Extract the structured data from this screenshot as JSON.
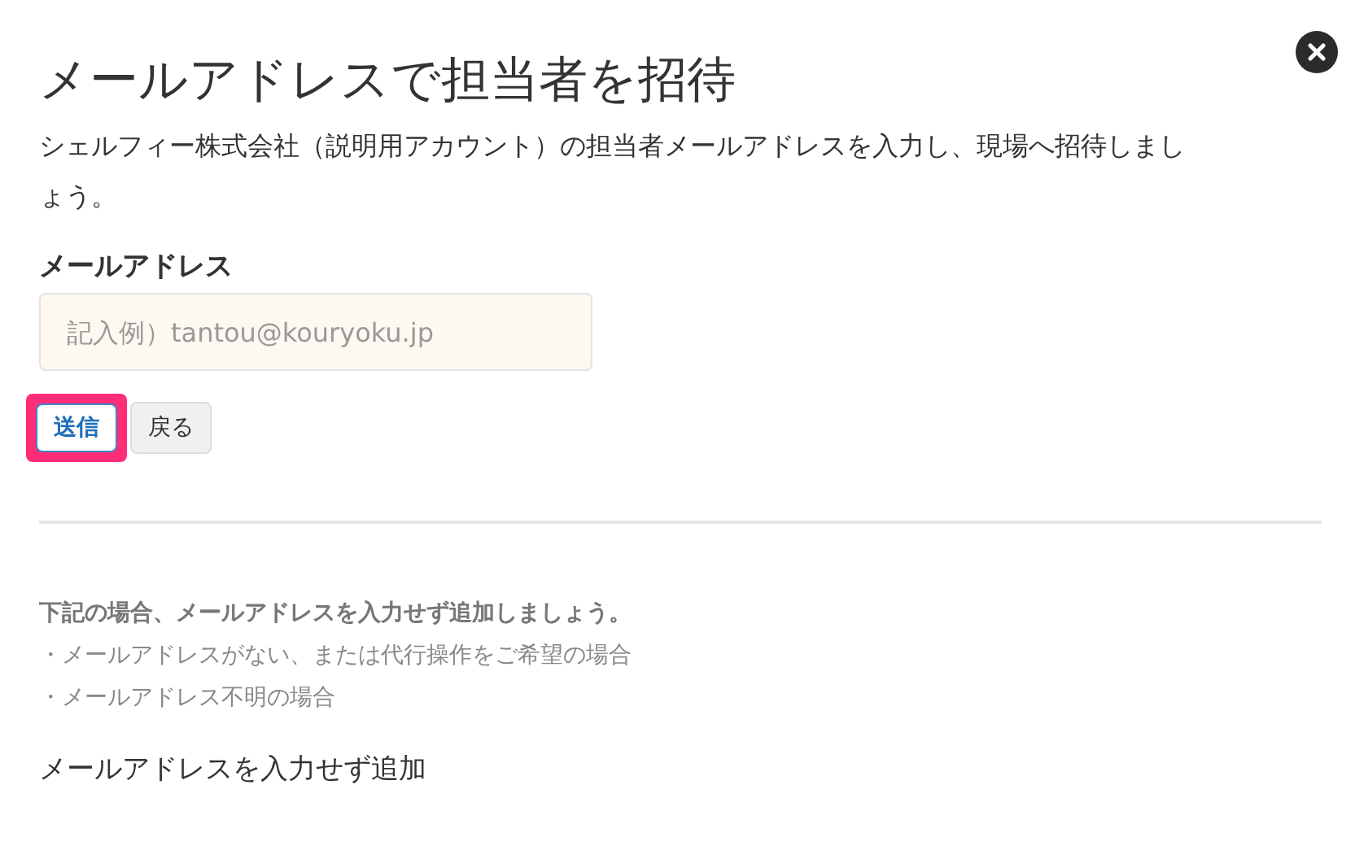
{
  "title": "メールアドレスで担当者を招待",
  "description": "シェルフィー株式会社（説明用アカウント）の担当者メールアドレスを入力し、現場へ招待しましょう。",
  "email_field": {
    "label": "メールアドレス",
    "placeholder": "記入例）tantou@kouryoku.jp"
  },
  "buttons": [
    {
      "label": "送信",
      "kind": "primary",
      "highlighted": true
    },
    {
      "label": "戻る",
      "kind": "secondary",
      "highlighted": false
    }
  ],
  "note": {
    "heading": "下記の場合、メールアドレスを入力せず追加しましょう。",
    "items": [
      "・メールアドレスがない、または代行操作をご希望の場合",
      "・メールアドレス不明の場合"
    ]
  },
  "add_without_email": "メールアドレスを入力せず追加"
}
